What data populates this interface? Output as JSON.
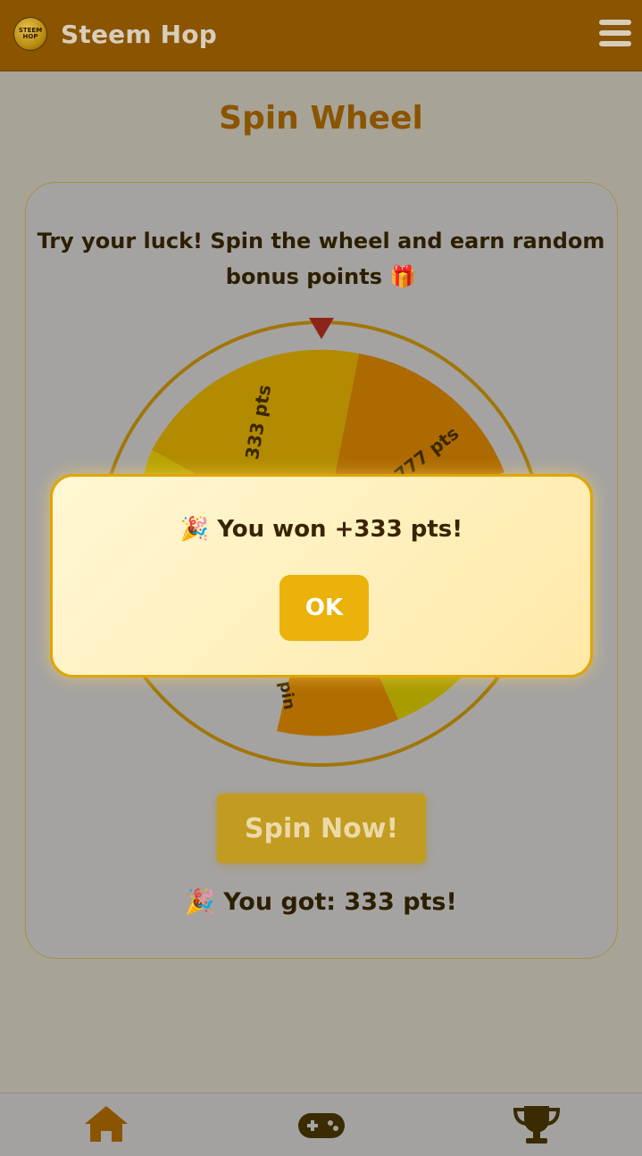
{
  "header": {
    "logo_text": "STEEM HOP",
    "app_title": "Steem Hop"
  },
  "page": {
    "title": "Spin Wheel",
    "intro": "Try your luck! Spin the wheel and earn random bonus points 🎁"
  },
  "wheel": {
    "labels": [
      "333 pts",
      "777 pts",
      "pin"
    ]
  },
  "actions": {
    "spin_label": "Spin Now!"
  },
  "result": {
    "text": "🎉 You got: 333 pts!"
  },
  "modal": {
    "message": "🎉 You won +333 pts!",
    "ok_label": "OK"
  },
  "bottom_nav": {
    "items": [
      "home-icon",
      "gamepad-icon",
      "trophy-icon"
    ]
  },
  "colors": {
    "header_bg": "#8a5400",
    "accent": "#eab20a",
    "title": "#8a5400"
  }
}
